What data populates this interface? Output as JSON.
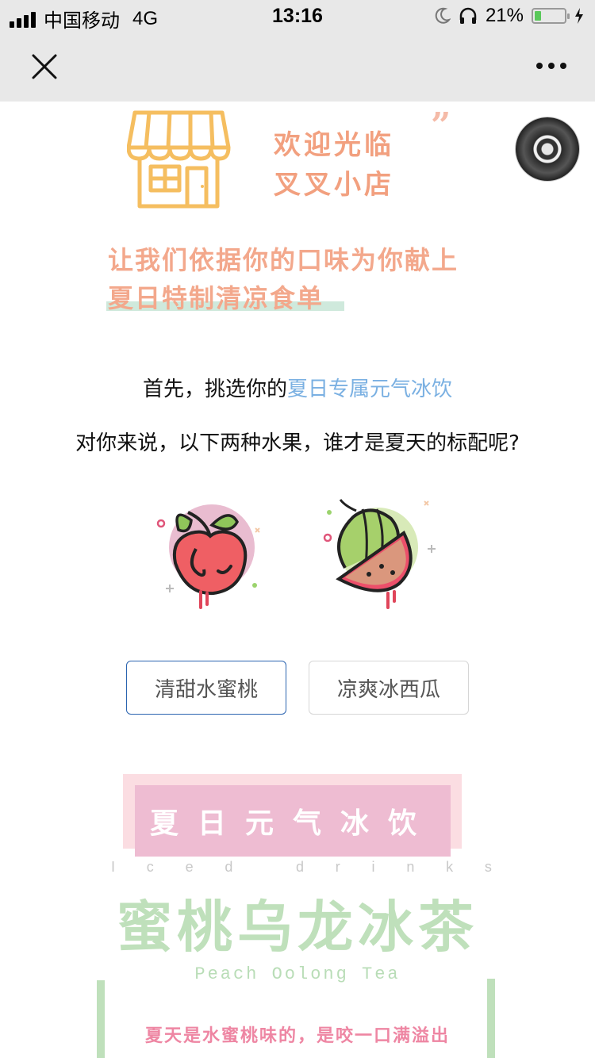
{
  "status_bar": {
    "carrier": "中国移动",
    "network": "4G",
    "time": "13:16",
    "battery": "21%",
    "battery_level": 0.21
  },
  "nav": {
    "close_icon": "close-icon",
    "more_icon": "more-dots-icon"
  },
  "header": {
    "welcome_line1": "欢迎光临",
    "welcome_line2": "叉叉小店",
    "quote_mark": "”"
  },
  "intro": {
    "line1": "让我们依据你的口味为你献上",
    "line2": "夏日特制清凉食单"
  },
  "question": {
    "line1_prefix": "首先，挑选你的",
    "line1_highlight": "夏日专属元气冰饮",
    "line2": "对你来说，以下两种水果，谁才是夏天的标配呢?"
  },
  "options": {
    "peach": "清甜水蜜桃",
    "watermelon": "凉爽冰西瓜"
  },
  "menu": {
    "banner": "夏日元气冰饮",
    "iced_label": [
      "I",
      "c",
      "e",
      "d",
      "",
      "d",
      "r",
      "i",
      "n",
      "k",
      "s"
    ],
    "drink_name_cn": "蜜桃乌龙冰茶",
    "drink_name_en": "Peach Oolong Tea",
    "description": "夏天是水蜜桃味的，是咬一口满溢出"
  },
  "colors": {
    "accent_orange": "#f2a07f",
    "highlight_blue": "#7ab0e2",
    "green": "#bfe0bb",
    "pink": "#eebcd2",
    "selected_border": "#2b64b0"
  }
}
